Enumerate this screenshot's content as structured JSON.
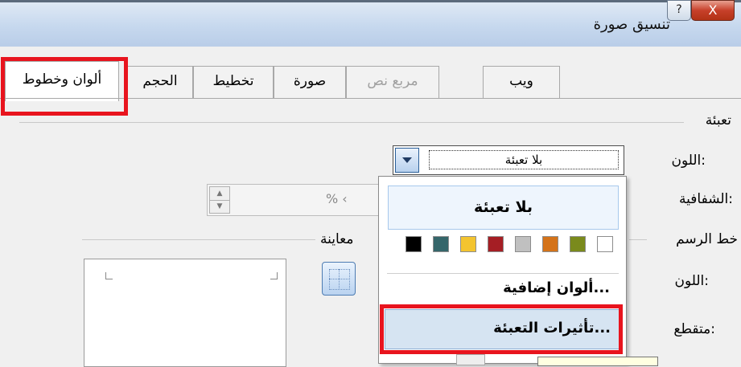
{
  "window": {
    "title": "تنسيق صورة",
    "close_glyph": "X",
    "help_glyph": "?"
  },
  "tabs": [
    {
      "label": "ألوان وخطوط",
      "state": "selected"
    },
    {
      "label": "الحجم",
      "state": "normal"
    },
    {
      "label": "تخطيط",
      "state": "normal"
    },
    {
      "label": "صورة",
      "state": "normal"
    },
    {
      "label": "مربع نص",
      "state": "disabled"
    },
    {
      "label": "ويب",
      "state": "normal"
    }
  ],
  "fill_section": {
    "heading": "تعبئة",
    "color_label": "اللون:",
    "color_value": "بلا تعبئة",
    "transparency_label": "الشفافية:",
    "transparency_value": "% ‹"
  },
  "line_section": {
    "heading": "خط الرسم",
    "preview_label": "معاينة",
    "color_label": "اللون:",
    "dashed_label": "متقطع:"
  },
  "spin": {
    "up": "▲",
    "down": "▼"
  },
  "dropdown_menu": {
    "no_fill_label": "بلا تعبئة",
    "swatches": [
      "#ffffff",
      "#7a8a1c",
      "#d4731a",
      "#c0c0c0",
      "#a51e24",
      "#f3c42f",
      "#35666a",
      "#000000"
    ],
    "more_colors_label": "ألوان إضافية...",
    "fill_effects_label": "تأثيرات التعبئة..."
  },
  "highlight_color": "#e8141e"
}
